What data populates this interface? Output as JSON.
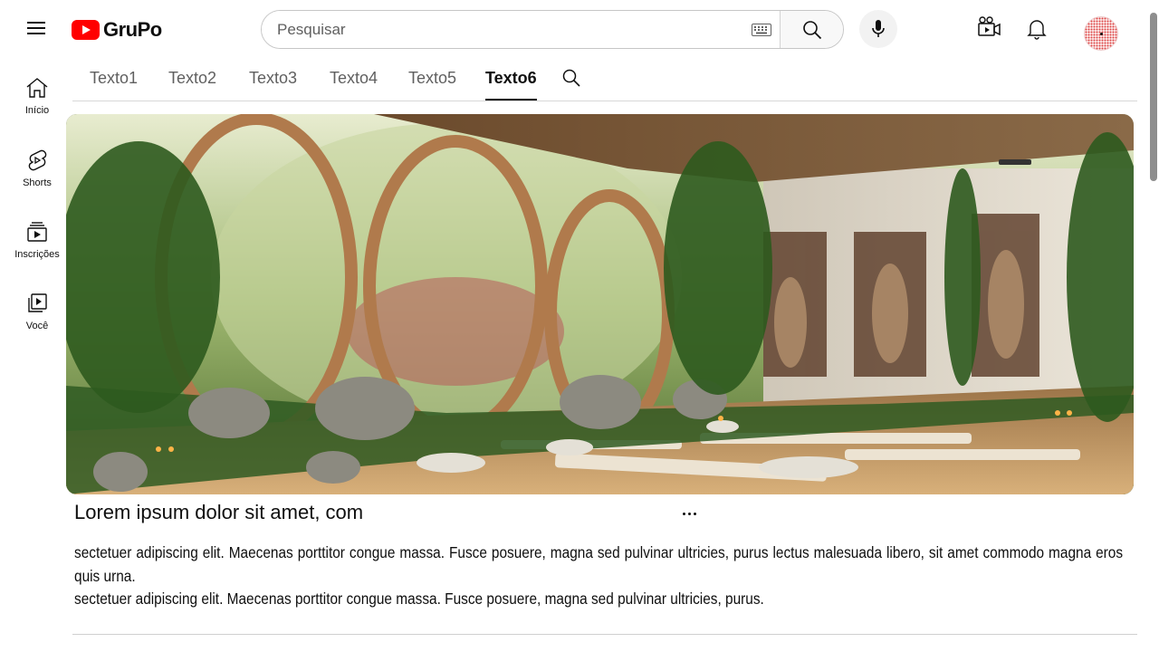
{
  "header": {
    "logo_text": "GruPo",
    "search_placeholder": "Pesquisar",
    "brand_color": "#ff0000"
  },
  "sidebar": {
    "items": [
      {
        "label": "Início",
        "icon": "home-icon"
      },
      {
        "label": "Shorts",
        "icon": "shorts-icon"
      },
      {
        "label": "Inscrições",
        "icon": "subscriptions-icon"
      },
      {
        "label": "Você",
        "icon": "you-icon"
      }
    ]
  },
  "tabs": {
    "items": [
      "Texto1",
      "Texto2",
      "Texto3",
      "Texto4",
      "Texto5",
      "Texto6"
    ],
    "active": "Texto6"
  },
  "post": {
    "image_description": "",
    "title": "Lorem ipsum dolor sit amet, com",
    "body_line1": "sectetuer adipiscing  elit. Maecenas porttitor congue  massa. Fusce posuere,  magna sed pulvinar  ultricies, purus lectus malesuada libero, sit amet commodo magna eros quis urna.",
    "body_line2": "sectetuer adipiscing  elit. Maecenas porttitor congue  massa. Fusce posuere,  magna sed pulvinar  ultricies, purus."
  }
}
